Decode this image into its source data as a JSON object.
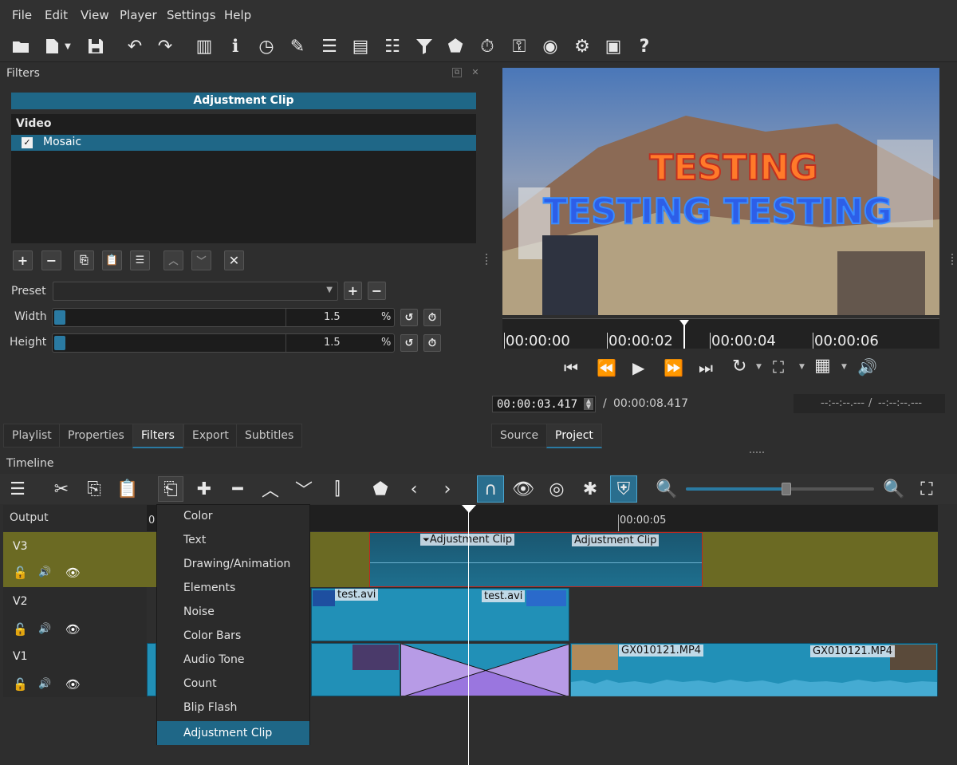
{
  "menu": [
    "File",
    "Edit",
    "View",
    "Player",
    "Settings",
    "Help"
  ],
  "filters_panel": {
    "title": "Filters",
    "clip_name": "Adjustment Clip",
    "category": "Video",
    "selected_filter": "Mosaic",
    "preset_label": "Preset",
    "preset_value": "",
    "params": [
      {
        "label": "Width",
        "value": "1.5",
        "unit": "%",
        "level_fraction": 0.03
      },
      {
        "label": "Height",
        "value": "1.5",
        "unit": "%",
        "level_fraction": 0.03
      }
    ]
  },
  "left_tabs": [
    "Playlist",
    "Properties",
    "Filters",
    "Export",
    "Subtitles"
  ],
  "right_tabs": [
    "Source",
    "Project"
  ],
  "player": {
    "ruler": [
      "00:00:00",
      "00:00:02",
      "00:00:04",
      "00:00:06"
    ],
    "current_time": "00:00:03.417",
    "separator": "/",
    "total_time": "00:00:08.417",
    "in_point": "--:--:--.---",
    "out_point": "--:--:--.---",
    "preview_text_line1": "TESTING",
    "preview_text_line2": "TESTING TESTING"
  },
  "timeline": {
    "title": "Timeline",
    "output_label": "Output",
    "ruler_start": "0",
    "ruler_mark": "00:00:05",
    "tracks": [
      {
        "name": "V3",
        "color": "#6b6a23"
      },
      {
        "name": "V2",
        "color": "#2b2b2b"
      },
      {
        "name": "V1",
        "color": "#2b2b2b"
      }
    ],
    "clips": {
      "v3_a": "Adjustment Clip",
      "v3_b": "Adjustment Clip",
      "v2_a": "test.avi",
      "v2_b": "test.avi",
      "v1_a": "GX010121.MP4",
      "v1_b": "GX010121.MP4"
    }
  },
  "context_menu": {
    "items": [
      "Color",
      "Text",
      "Drawing/Animation",
      "Elements",
      "Noise",
      "Color Bars",
      "Audio Tone",
      "Count",
      "Blip Flash",
      "Adjustment Clip"
    ],
    "selected": "Adjustment Clip"
  },
  "colors": {
    "accent": "#1f6787",
    "clip": "#2190b7",
    "v3_track": "#6b6a23",
    "transition": "#b79be6"
  }
}
